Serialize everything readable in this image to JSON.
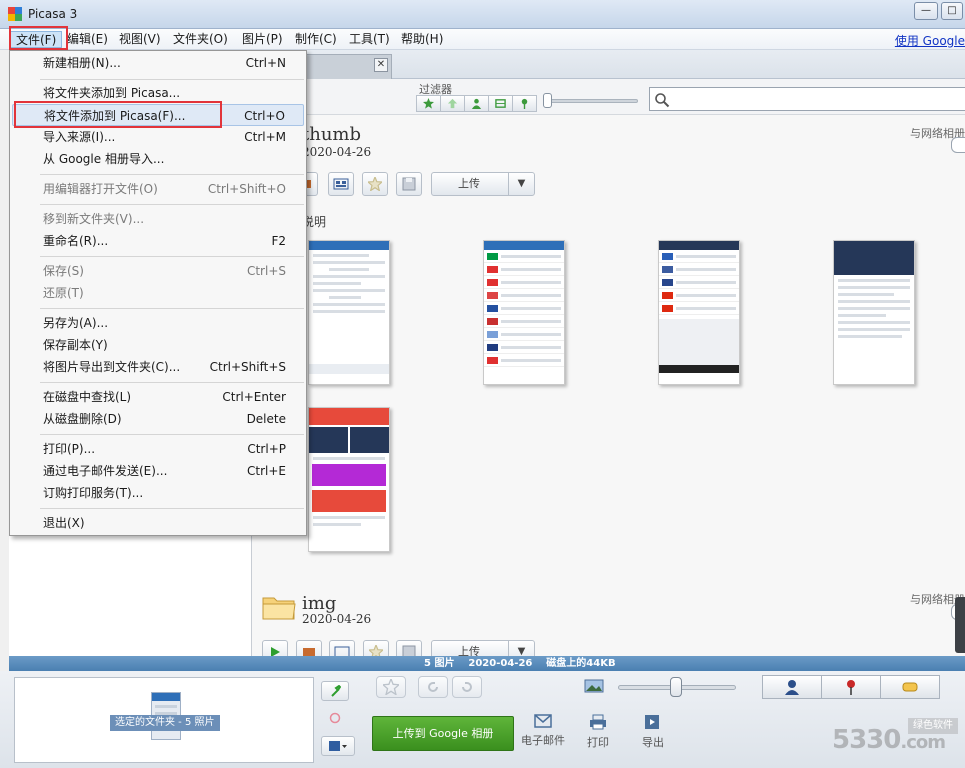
{
  "window": {
    "title": "Picasa 3"
  },
  "menubar": {
    "items": [
      "文件(F)",
      "编辑(E)",
      "视图(V)",
      "文件夹(O)",
      "图片(P)",
      "制作(C)",
      "工具(T)",
      "帮助(H)"
    ],
    "google_link": "使用 Google"
  },
  "file_menu": [
    {
      "label": "新建相册(N)...",
      "shortcut": "Ctrl+N",
      "disabled": false
    },
    {
      "label": "将文件夹添加到 Picasa...",
      "shortcut": "",
      "disabled": false
    },
    {
      "label": "将文件添加到 Picasa(F)...",
      "shortcut": "Ctrl+O",
      "disabled": false,
      "highlighted": true
    },
    {
      "label": "导入来源(I)...",
      "shortcut": "Ctrl+M",
      "disabled": false
    },
    {
      "label": "从 Google 相册导入...",
      "shortcut": "",
      "disabled": false
    },
    {
      "label": "用编辑器打开文件(O)",
      "shortcut": "Ctrl+Shift+O",
      "disabled": true
    },
    {
      "label": "移到新文件夹(V)...",
      "shortcut": "",
      "disabled": true
    },
    {
      "label": "重命名(R)...",
      "shortcut": "F2",
      "disabled": false
    },
    {
      "label": "保存(S)",
      "shortcut": "Ctrl+S",
      "disabled": true
    },
    {
      "label": "还原(T)",
      "shortcut": "",
      "disabled": true
    },
    {
      "label": "另存为(A)...",
      "shortcut": "",
      "disabled": false
    },
    {
      "label": "保存副本(Y)",
      "shortcut": "",
      "disabled": false
    },
    {
      "label": "将图片导出到文件夹(C)...",
      "shortcut": "Ctrl+Shift+S",
      "disabled": false
    },
    {
      "label": "在磁盘中查找(L)",
      "shortcut": "Ctrl+Enter",
      "disabled": false
    },
    {
      "label": "从磁盘删除(D)",
      "shortcut": "Delete",
      "disabled": false
    },
    {
      "label": "打印(P)...",
      "shortcut": "Ctrl+P",
      "disabled": false
    },
    {
      "label": "通过电子邮件发送(E)...",
      "shortcut": "Ctrl+E",
      "disabled": false
    },
    {
      "label": "订购打印服务(T)...",
      "shortcut": "",
      "disabled": false
    },
    {
      "label": "退出(X)",
      "shortcut": "",
      "disabled": false
    }
  ],
  "filter": {
    "label": "过滤器",
    "search_placeholder": ""
  },
  "albums": [
    {
      "name": "thumb",
      "date": "2020-04-26",
      "sync_label": "与网络相册",
      "upload_label": "上传",
      "desc_label": "说明"
    },
    {
      "name": "img",
      "date": "2020-04-26",
      "sync_label": "与网络相册",
      "upload_label": "上传"
    }
  ],
  "status": {
    "count": "5 图片",
    "date": "2020-04-26",
    "disk": "磁盘上的44KB"
  },
  "tray": {
    "label": "选定的文件夹 - 5 照片"
  },
  "actions": {
    "share": "上传到 Google 相册",
    "email": "电子邮件",
    "print": "打印",
    "export": "导出"
  },
  "watermark": {
    "brand": "5330",
    "suffix": ".com",
    "tag": "绿色软件"
  },
  "colors": {
    "accent": "#4a7fb1",
    "share_green": "#3a8f1e",
    "highlight_red": "#e2343a"
  }
}
